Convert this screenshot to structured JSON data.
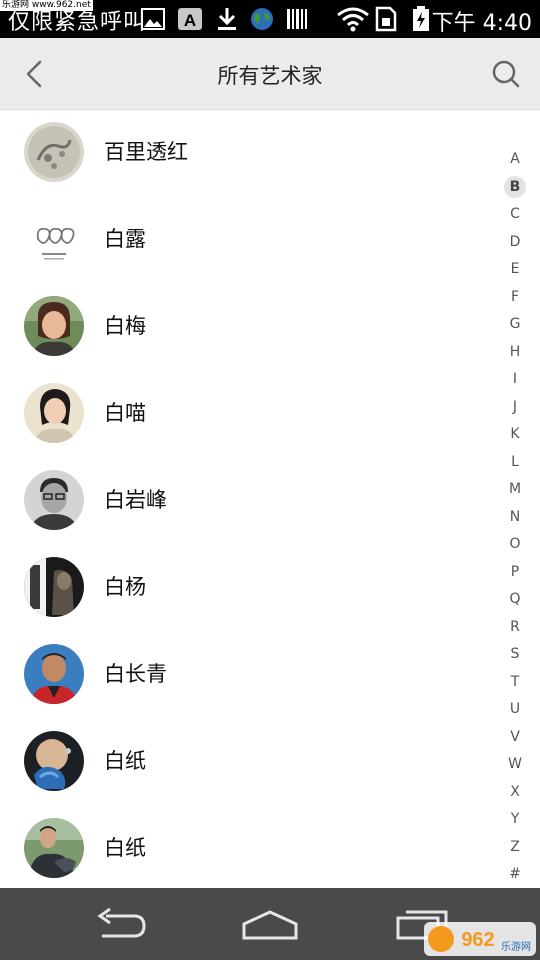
{
  "status_bar": {
    "left_text": "仅限紧急呼叫",
    "watermark": "乐游网 www.962.net",
    "network_label": "下午",
    "time": "4:40"
  },
  "header": {
    "title": "所有艺术家"
  },
  "artists": [
    {
      "name": "百里透红"
    },
    {
      "name": "白露"
    },
    {
      "name": "白梅"
    },
    {
      "name": "白喵"
    },
    {
      "name": "白岩峰"
    },
    {
      "name": "白杨"
    },
    {
      "name": "白长青"
    },
    {
      "name": "白纸"
    },
    {
      "name": "白纸"
    }
  ],
  "index_letters": [
    "A",
    "B",
    "C",
    "D",
    "E",
    "F",
    "G",
    "H",
    "I",
    "J",
    "K",
    "L",
    "M",
    "N",
    "O",
    "P",
    "Q",
    "R",
    "S",
    "T",
    "U",
    "V",
    "W",
    "X",
    "Y",
    "Z",
    "#"
  ],
  "index_active": "B",
  "nav": {
    "watermark_text": "962",
    "watermark_sub": "乐游网"
  }
}
